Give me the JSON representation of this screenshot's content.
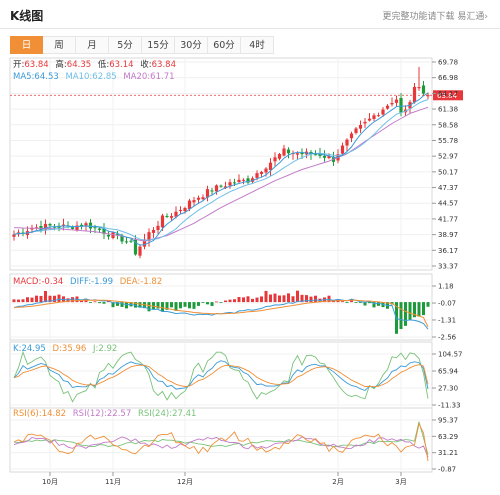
{
  "header": {
    "title": "K线图",
    "more_link": "更完整功能请下载 易汇通›"
  },
  "tabs": [
    {
      "label": "日",
      "active": true
    },
    {
      "label": "周",
      "active": false
    },
    {
      "label": "月",
      "active": false
    },
    {
      "label": "5分",
      "active": false
    },
    {
      "label": "15分",
      "active": false
    },
    {
      "label": "30分",
      "active": false
    },
    {
      "label": "60分",
      "active": false
    },
    {
      "label": "4时",
      "active": false
    }
  ],
  "colors": {
    "up": "#e8373a",
    "down": "#1d9b3a",
    "ma5": "#3b9bd8",
    "ma10": "#6fbfe8",
    "ma20": "#c27ac9",
    "dif": "#3b9bd8",
    "dea": "#f08f36",
    "k": "#3b9bd8",
    "d": "#f08f36",
    "j": "#78c278",
    "rsi6": "#f08f36",
    "rsi12": "#c27ac9",
    "rsi24": "#78c278",
    "price_line": "#e8373a",
    "accent": "#f08f36"
  },
  "chart_data": [
    {
      "type": "candlestick",
      "info": {
        "open_label": "开:",
        "open": "63.84",
        "high_label": "高:",
        "high": "64.35",
        "low_label": "低:",
        "low": "63.14",
        "close_label": "收:",
        "close": "63.84",
        "ma5_label": "MA5:",
        "ma5": "64.53",
        "ma10_label": "MA10:",
        "ma10": "62.85",
        "ma20_label": "MA20:",
        "ma20": "61.71"
      },
      "ylim": [
        33.37,
        69.78
      ],
      "y_ticks": [
        "69.78",
        "66.98",
        "64.17",
        "61.38",
        "58.58",
        "55.78",
        "52.97",
        "50.17",
        "47.37",
        "44.57",
        "41.77",
        "38.97",
        "36.17",
        "33.37"
      ],
      "last_price": "63.84",
      "x_ticks": [
        {
          "label": "10月",
          "idx": 8
        },
        {
          "label": "11月",
          "idx": 22
        },
        {
          "label": "12月",
          "idx": 38
        },
        {
          "label": "2月",
          "idx": 72
        },
        {
          "label": "3月",
          "idx": 86
        }
      ],
      "anchors": [
        [
          0,
          39.0
        ],
        [
          4,
          40.2
        ],
        [
          8,
          40.5
        ],
        [
          12,
          40.4
        ],
        [
          16,
          40.8
        ],
        [
          20,
          39.5
        ],
        [
          24,
          38.2
        ],
        [
          26,
          37.3
        ],
        [
          27,
          35.8
        ],
        [
          30,
          39.2
        ],
        [
          33,
          41.8
        ],
        [
          36,
          43.0
        ],
        [
          40,
          45.3
        ],
        [
          44,
          47.0
        ],
        [
          48,
          48.2
        ],
        [
          52,
          48.7
        ],
        [
          56,
          51.3
        ],
        [
          60,
          53.8
        ],
        [
          64,
          53.4
        ],
        [
          68,
          53.3
        ],
        [
          71,
          52.4
        ],
        [
          72,
          53.6
        ],
        [
          76,
          57.4
        ],
        [
          80,
          60.2
        ],
        [
          84,
          62.8
        ],
        [
          85,
          63.2
        ],
        [
          86,
          60.5
        ],
        [
          87,
          61.0
        ],
        [
          89,
          64.8
        ],
        [
          90,
          65.9
        ],
        [
          91,
          64.3
        ],
        [
          92,
          63.84
        ]
      ],
      "ma20_anchors": [
        [
          0,
          40.2
        ],
        [
          10,
          40.0
        ],
        [
          18,
          39.5
        ],
        [
          24,
          38.7
        ],
        [
          29,
          37.8
        ],
        [
          34,
          38.8
        ],
        [
          40,
          41.0
        ],
        [
          46,
          43.8
        ],
        [
          52,
          46.2
        ],
        [
          58,
          48.6
        ],
        [
          64,
          50.6
        ],
        [
          70,
          52.1
        ],
        [
          74,
          53.4
        ],
        [
          78,
          55.6
        ],
        [
          84,
          58.8
        ],
        [
          88,
          60.6
        ],
        [
          92,
          61.71
        ]
      ]
    },
    {
      "type": "macd",
      "info": {
        "macd_label": "MACD:",
        "macd": "-0.34",
        "dif_label": "DIFF:",
        "dif": "-1.99",
        "dea_label": "DEA:",
        "dea": "-1.82"
      },
      "ylim": [
        -2.56,
        1.18
      ],
      "y_ticks": [
        "1.18",
        "-0.07",
        "-1.31",
        "-2.56"
      ]
    },
    {
      "type": "kdj",
      "info": {
        "k_label": "K:",
        "k": "24.95",
        "d_label": "D:",
        "d": "35.96",
        "j_label": "J:",
        "j": "2.92"
      },
      "ylim": [
        -11.33,
        104.57
      ],
      "y_ticks": [
        "104.57",
        "65.94",
        "27.30",
        "-11.33"
      ]
    },
    {
      "type": "rsi",
      "info": {
        "rsi6_label": "RSI(6):",
        "rsi6": "14.82",
        "rsi12_label": "RSI(12):",
        "rsi12": "22.57",
        "rsi24_label": "RSI(24):",
        "rsi24": "27.41"
      },
      "ylim": [
        -0.87,
        95.37
      ],
      "y_ticks": [
        "95.37",
        "63.29",
        "31.21",
        "-0.87"
      ]
    }
  ]
}
